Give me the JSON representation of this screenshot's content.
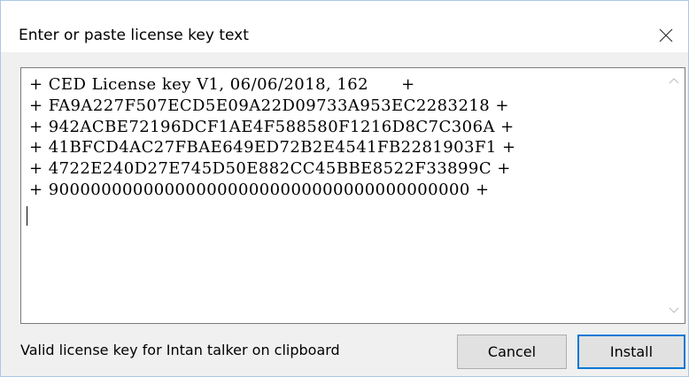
{
  "dialog": {
    "title": "Enter or paste license key text",
    "close_icon": "close-icon"
  },
  "license_text": {
    "lines": [
      "+ CED License key V1, 06/06/2018, 162      +",
      "+ FA9A227F507ECD5E09A22D09733A953EC2283218 +",
      "+ 942ACBE72196DCF1AE4F588580F1216D8C7C306A +",
      "+ 41BFCD4AC27FBAE649ED72B2E4541FB2281903F1 +",
      "+ 4722E240D27E745D50E882CC45BBE8522F33899C +",
      "+ 9000000000000000000000000000000000000000 +"
    ],
    "scroll_up_icon": "chevron-up-icon",
    "scroll_down_icon": "chevron-down-icon"
  },
  "footer": {
    "status": "Valid license key for Intan talker on clipboard",
    "cancel_label": "Cancel",
    "install_label": "Install"
  },
  "colors": {
    "dialog_background": "#f0f0f0",
    "primary_button_border": "#0078d7",
    "button_background": "#e1e1e1"
  }
}
